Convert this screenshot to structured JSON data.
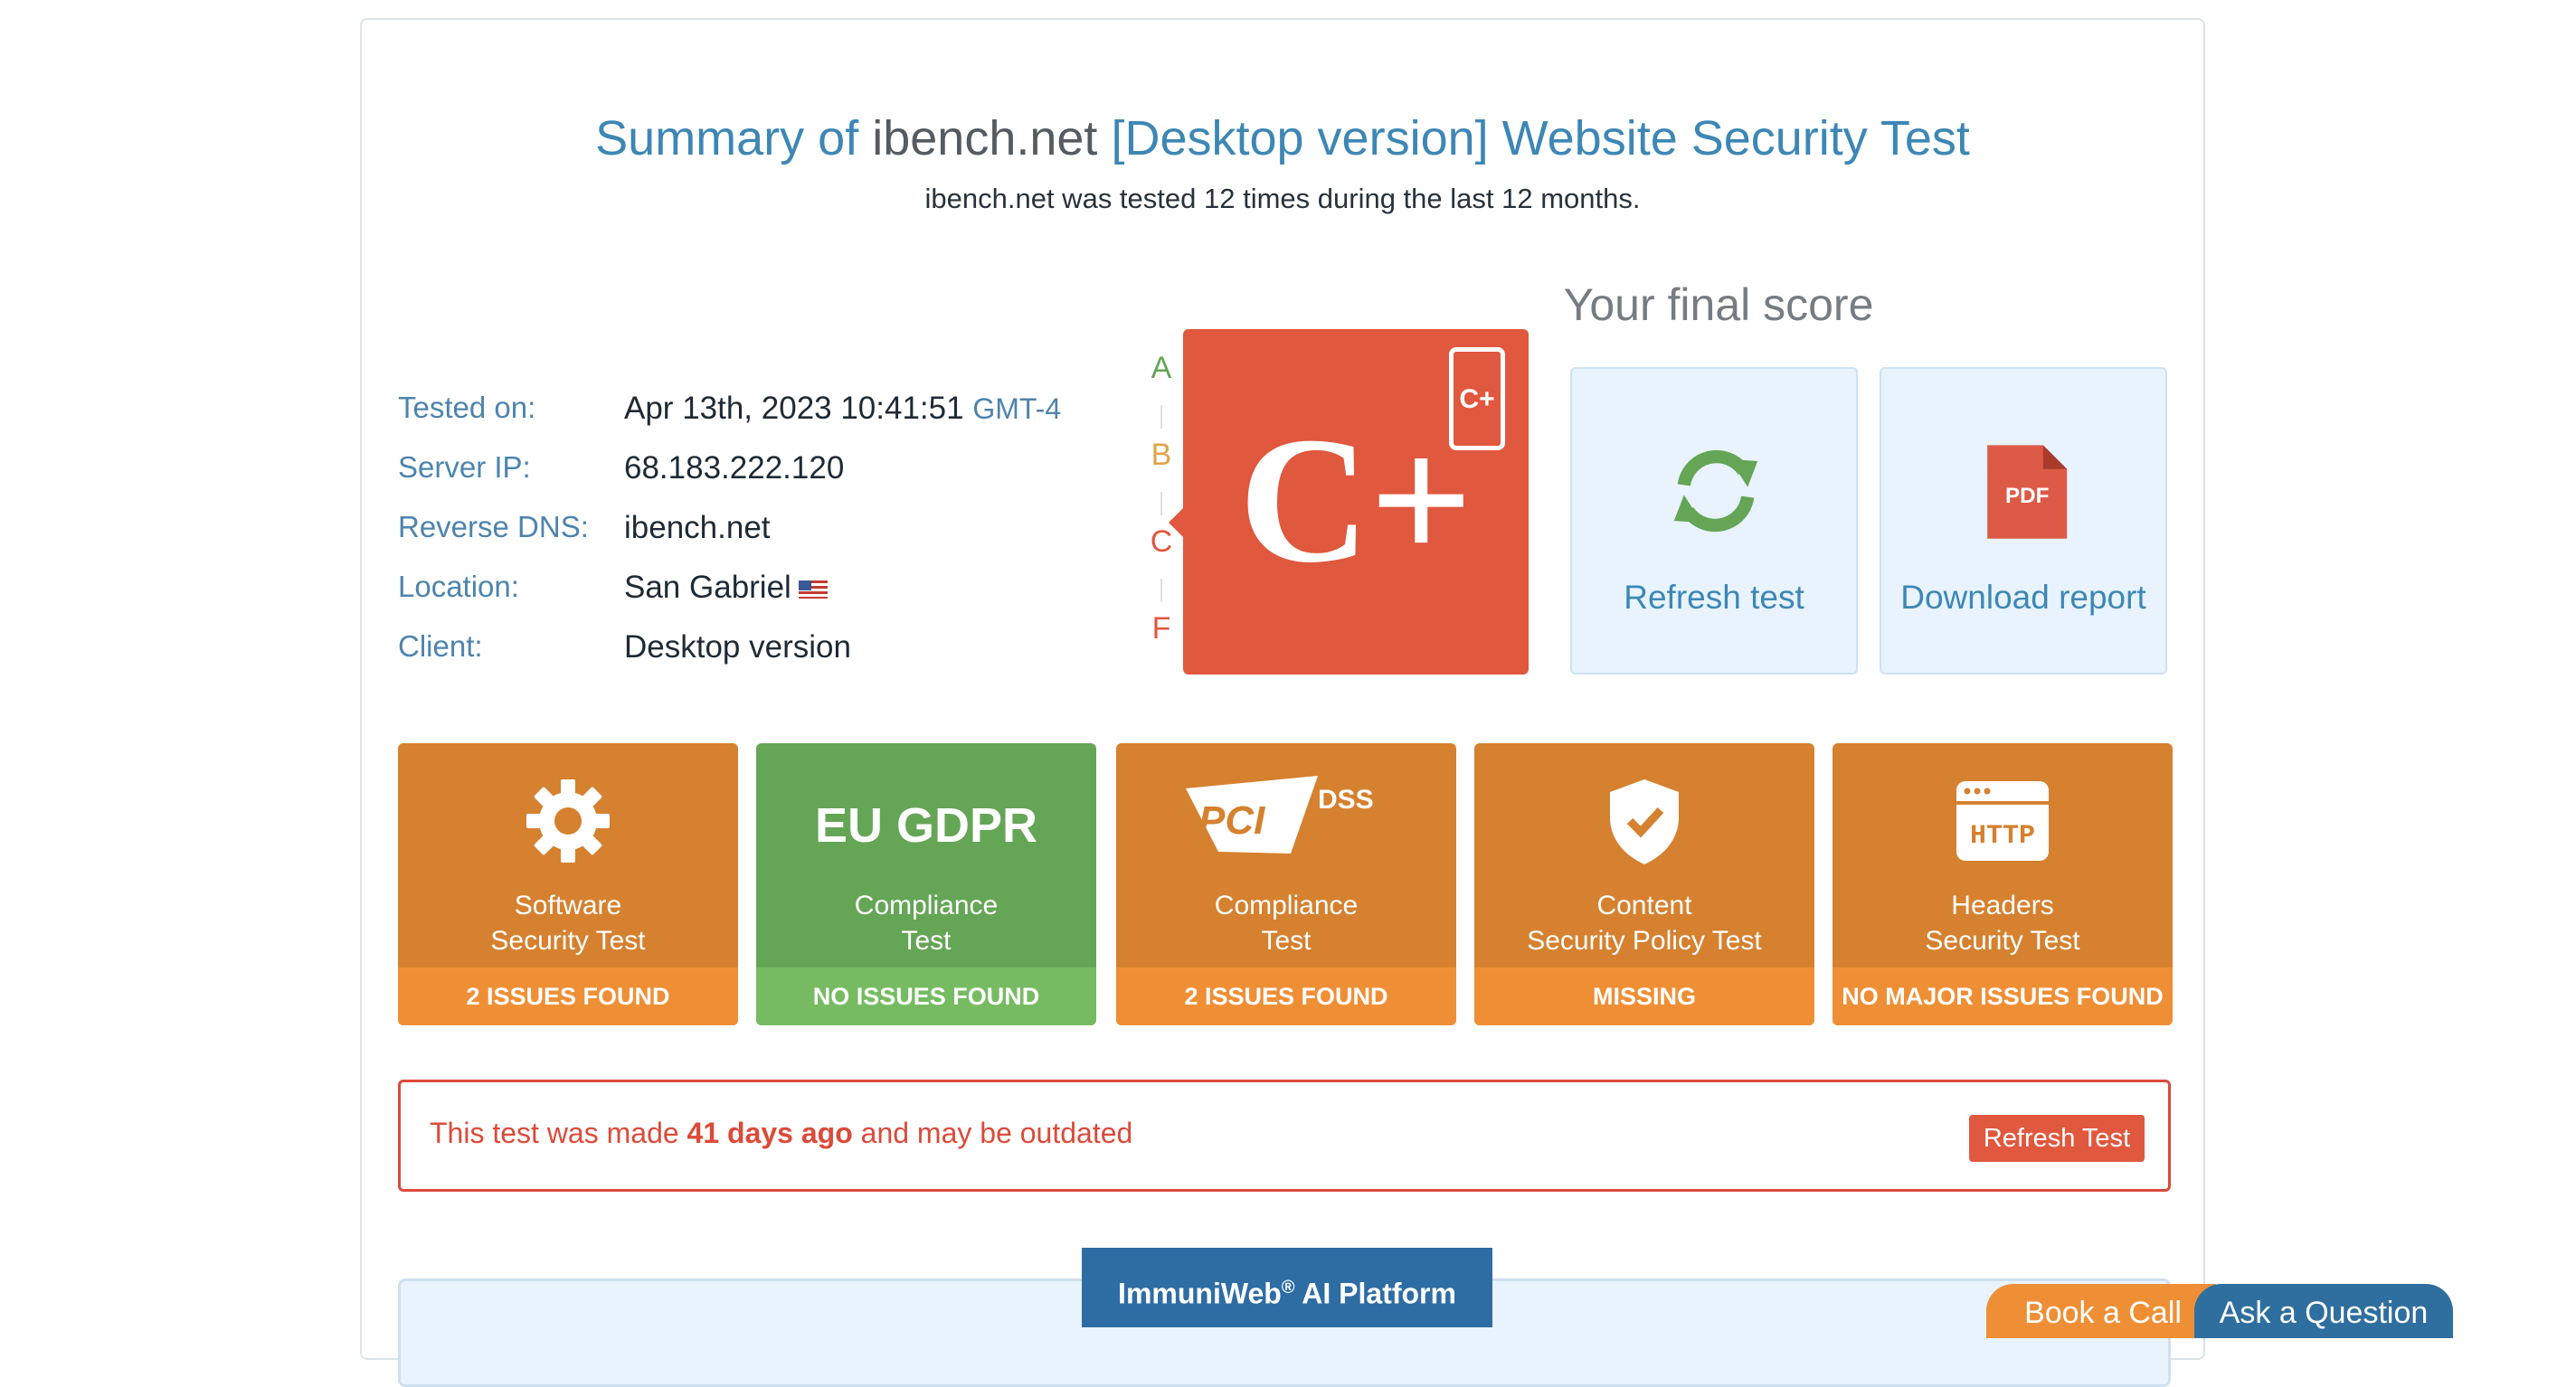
{
  "header": {
    "title_prefix": "Summary of",
    "title_host": "ibench.net",
    "title_suffix": "[Desktop version] Website Security Test",
    "subtitle": "ibench.net was tested 12 times during the last 12 months."
  },
  "info": {
    "tested_on_label": "Tested on:",
    "tested_on_value": "Apr 13th, 2023 10:41:51",
    "tested_on_tz": "GMT-4",
    "server_ip_label": "Server IP:",
    "server_ip_value": "68.183.222.120",
    "reverse_dns_label": "Reverse DNS:",
    "reverse_dns_value": "ibench.net",
    "location_label": "Location:",
    "location_value": "San Gabriel",
    "client_label": "Client:",
    "client_value": "Desktop version"
  },
  "score": {
    "heading": "Your final score",
    "grade": "C+",
    "mobile_grade": "C+",
    "scale": [
      "A",
      "B",
      "C",
      "F"
    ]
  },
  "actions": {
    "refresh": "Refresh test",
    "download": "Download report",
    "pdf_label": "PDF"
  },
  "tiles": [
    {
      "name_line1": "Software",
      "name_line2": "Security Test",
      "status": "2 ISSUES FOUND",
      "icon": "gear-icon"
    },
    {
      "name_line1": "Compliance",
      "name_line2": "Test",
      "status": "NO ISSUES FOUND",
      "icon": "eu-gdpr-logo",
      "logo_text": "EU GDPR"
    },
    {
      "name_line1": "Compliance",
      "name_line2": "Test",
      "status": "2 ISSUES FOUND",
      "icon": "pci-dss-logo",
      "logo_text": "PCI DSS"
    },
    {
      "name_line1": "Content",
      "name_line2": "Security Policy Test",
      "status": "MISSING",
      "icon": "shield-check-icon"
    },
    {
      "name_line1": "Headers",
      "name_line2": "Security Test",
      "status": "NO MAJOR ISSUES FOUND",
      "icon": "http-icon",
      "logo_text": "HTTP"
    }
  ],
  "warning": {
    "prefix": "This test was made",
    "days": "41 days ago",
    "suffix": "and may be outdated",
    "button": "Refresh Test"
  },
  "platform": {
    "name": "ImmuniWeb",
    "reg": "®",
    "rest": "AI Platform"
  },
  "floating": {
    "book_call": "Book a Call",
    "ask_question": "Ask a Question"
  },
  "colors": {
    "accent_blue": "#3d87b5",
    "grade_red": "#e0583e",
    "tile_orange": "#d5812f",
    "tile_green": "#65a556",
    "warning_red": "#dc4a39"
  }
}
